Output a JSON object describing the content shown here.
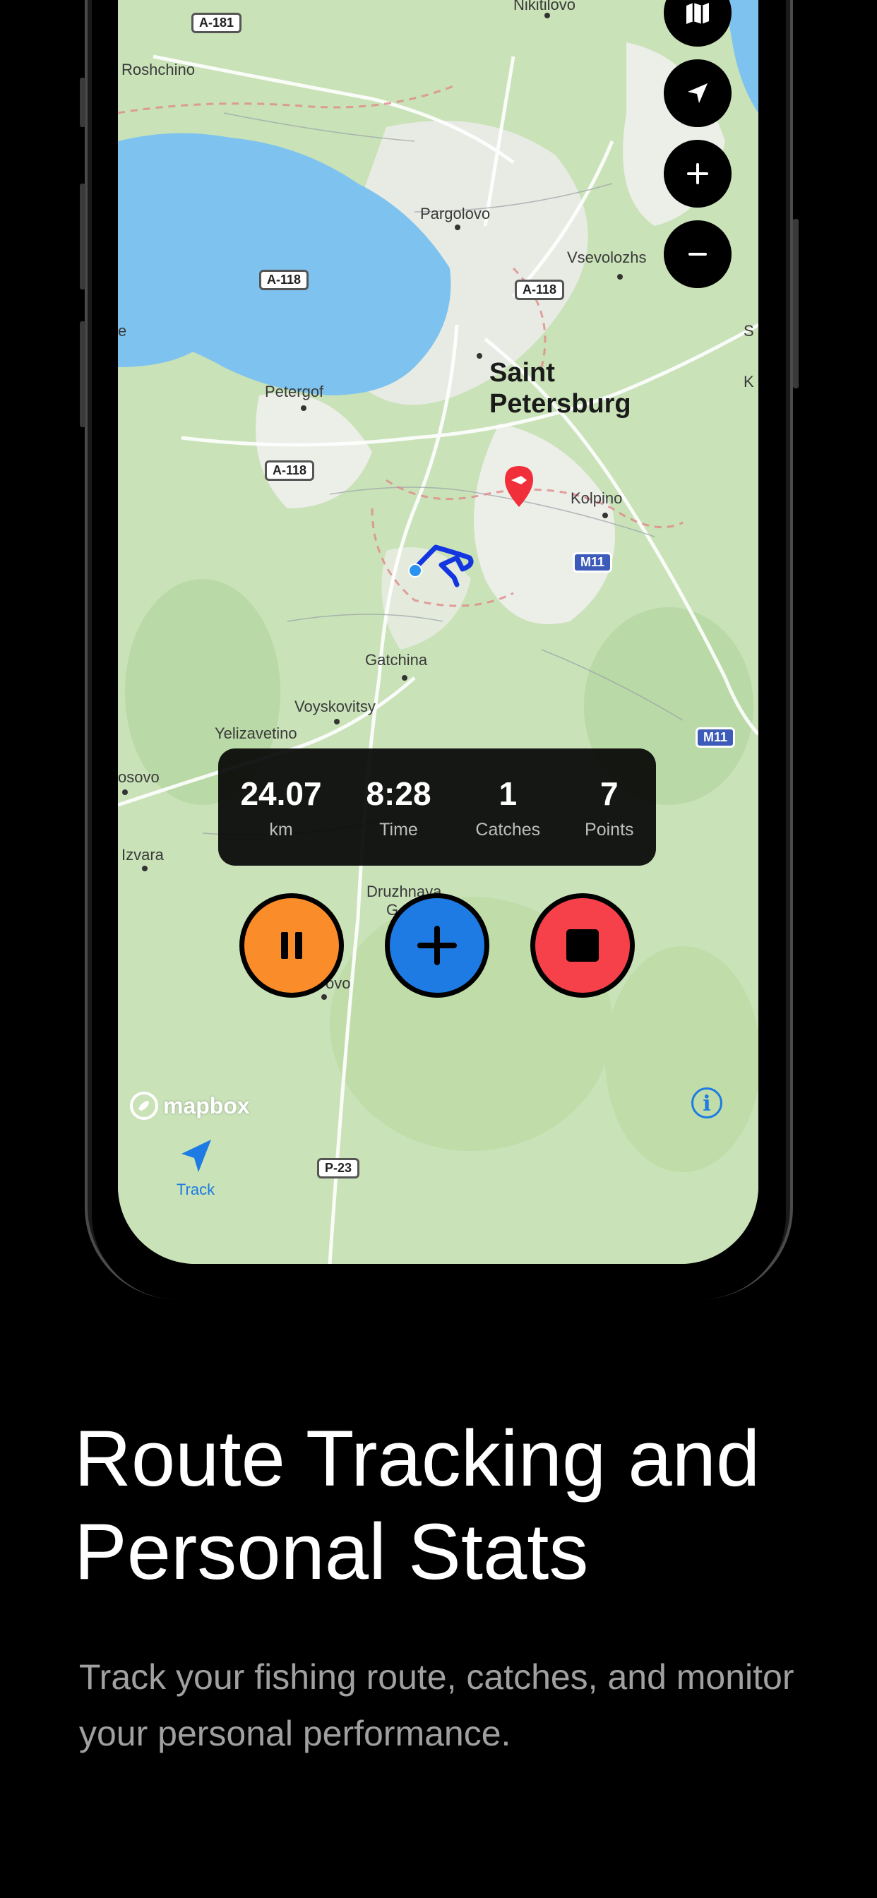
{
  "map": {
    "labels": {
      "nikitilovo": "Nikitilovo",
      "roshchino": "Roshchino",
      "pargolovo": "Pargolovo",
      "vsevolozhsk": "Vsevolozhs",
      "petergof": "Petergof",
      "kolpino": "Kolpino",
      "gatchina": "Gatchina",
      "voyskovitsy": "Voyskovitsy",
      "yelizavetino": "Yelizavetino",
      "osovo": "osovo",
      "izvara": "Izvara",
      "druzhnaya": "Druzhnaya",
      "druzhnaya2": "G",
      "ovo": "ovo",
      "left_e": "e",
      "right_s": "S",
      "right_k": "K",
      "city_line1": "Saint",
      "city_line2": "Petersburg"
    },
    "shields": {
      "a181": "A-181",
      "a118_1": "A-118",
      "a118_2": "A-118",
      "a118_3": "A-118",
      "m11_1": "M11",
      "m11_2": "M11",
      "p23": "P-23"
    },
    "controls": [
      "map-layers-icon",
      "locate-icon",
      "plus-icon",
      "minus-icon"
    ]
  },
  "stats": [
    {
      "value": "24.07",
      "label": "km"
    },
    {
      "value": "8:28",
      "label": "Time"
    },
    {
      "value": "1",
      "label": "Catches"
    },
    {
      "value": "7",
      "label": "Points"
    }
  ],
  "controls": {
    "pause_color": "#fb8c2a",
    "add_color": "#1e7be3",
    "stop_color": "#f6414a"
  },
  "tabbar": {
    "track_label": "Track"
  },
  "attribution": {
    "mapbox": "mapbox"
  },
  "promo": {
    "headline": "Route Tracking and Personal Stats",
    "subtitle": "Track your fishing route, catches, and monitor your personal performance."
  }
}
